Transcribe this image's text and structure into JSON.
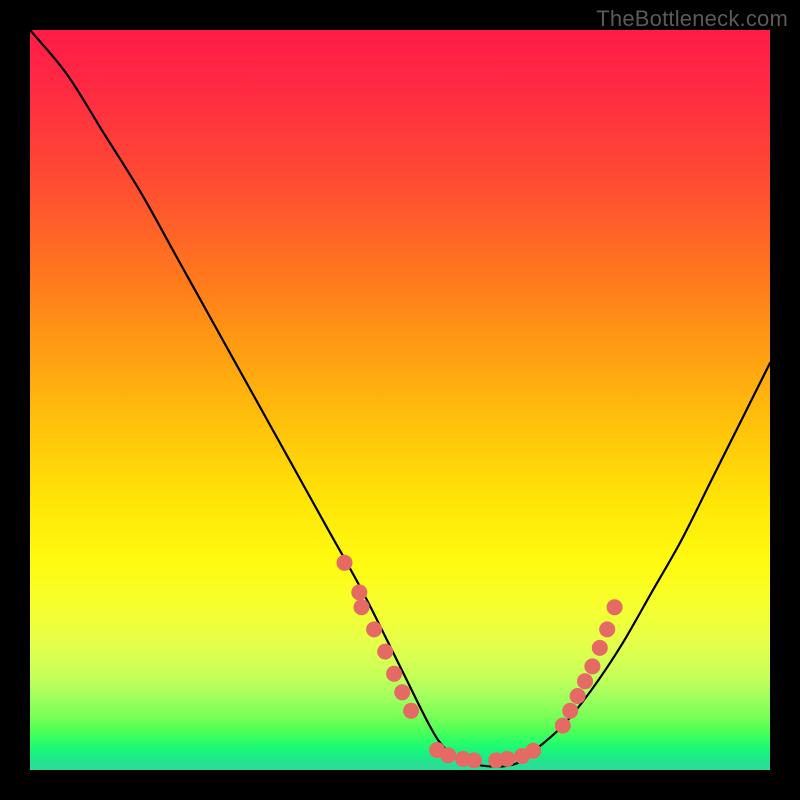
{
  "attribution": "TheBottleneck.com",
  "colors": {
    "background": "#000000",
    "gradient_top": "#ff1c47",
    "gradient_mid": "#ffe607",
    "gradient_bottom": "#2cdc97",
    "curve": "#000000",
    "marker": "#e46a63"
  },
  "chart_data": {
    "type": "line",
    "title": "",
    "xlabel": "",
    "ylabel": "",
    "xlim": [
      0,
      100
    ],
    "ylim": [
      0,
      100
    ],
    "grid": false,
    "legend": false,
    "notes": "V-shaped bottleneck curve. Left branch nearly linear descent from (0,100) to ~(55,0). Flat minimum along y≈0 from x≈55 to x≈67. Right branch rises with increasing slope to ~(100,55). Salmon markers cluster on both branches roughly between y=6 and y=23 and along the flat bottom.",
    "series": [
      {
        "name": "bottleneck-curve",
        "x": [
          0,
          5,
          10,
          15,
          20,
          25,
          30,
          35,
          40,
          45,
          50,
          54,
          56,
          58,
          60,
          62,
          64,
          66,
          68,
          72,
          76,
          80,
          84,
          88,
          92,
          96,
          100
        ],
        "y": [
          100,
          94,
          86,
          78,
          69,
          60,
          51,
          42,
          33,
          24,
          14,
          6,
          3,
          1.5,
          0.8,
          0.5,
          0.5,
          1,
          2.5,
          6,
          11,
          17,
          24,
          31,
          39,
          47,
          55
        ]
      }
    ],
    "markers": [
      {
        "x": 42.5,
        "y": 28
      },
      {
        "x": 44.5,
        "y": 24
      },
      {
        "x": 44.8,
        "y": 22
      },
      {
        "x": 46.5,
        "y": 19
      },
      {
        "x": 48.0,
        "y": 16
      },
      {
        "x": 49.2,
        "y": 13
      },
      {
        "x": 50.3,
        "y": 10.5
      },
      {
        "x": 51.5,
        "y": 8
      },
      {
        "x": 55.0,
        "y": 2.7
      },
      {
        "x": 56.5,
        "y": 2.0
      },
      {
        "x": 58.5,
        "y": 1.5
      },
      {
        "x": 60.0,
        "y": 1.3
      },
      {
        "x": 63.0,
        "y": 1.3
      },
      {
        "x": 64.5,
        "y": 1.5
      },
      {
        "x": 66.5,
        "y": 1.9
      },
      {
        "x": 68.0,
        "y": 2.6
      },
      {
        "x": 72.0,
        "y": 6
      },
      {
        "x": 73.0,
        "y": 8
      },
      {
        "x": 74.0,
        "y": 10
      },
      {
        "x": 75.0,
        "y": 12
      },
      {
        "x": 76.0,
        "y": 14
      },
      {
        "x": 77.0,
        "y": 16.5
      },
      {
        "x": 78.0,
        "y": 19
      },
      {
        "x": 79.0,
        "y": 22
      }
    ]
  }
}
